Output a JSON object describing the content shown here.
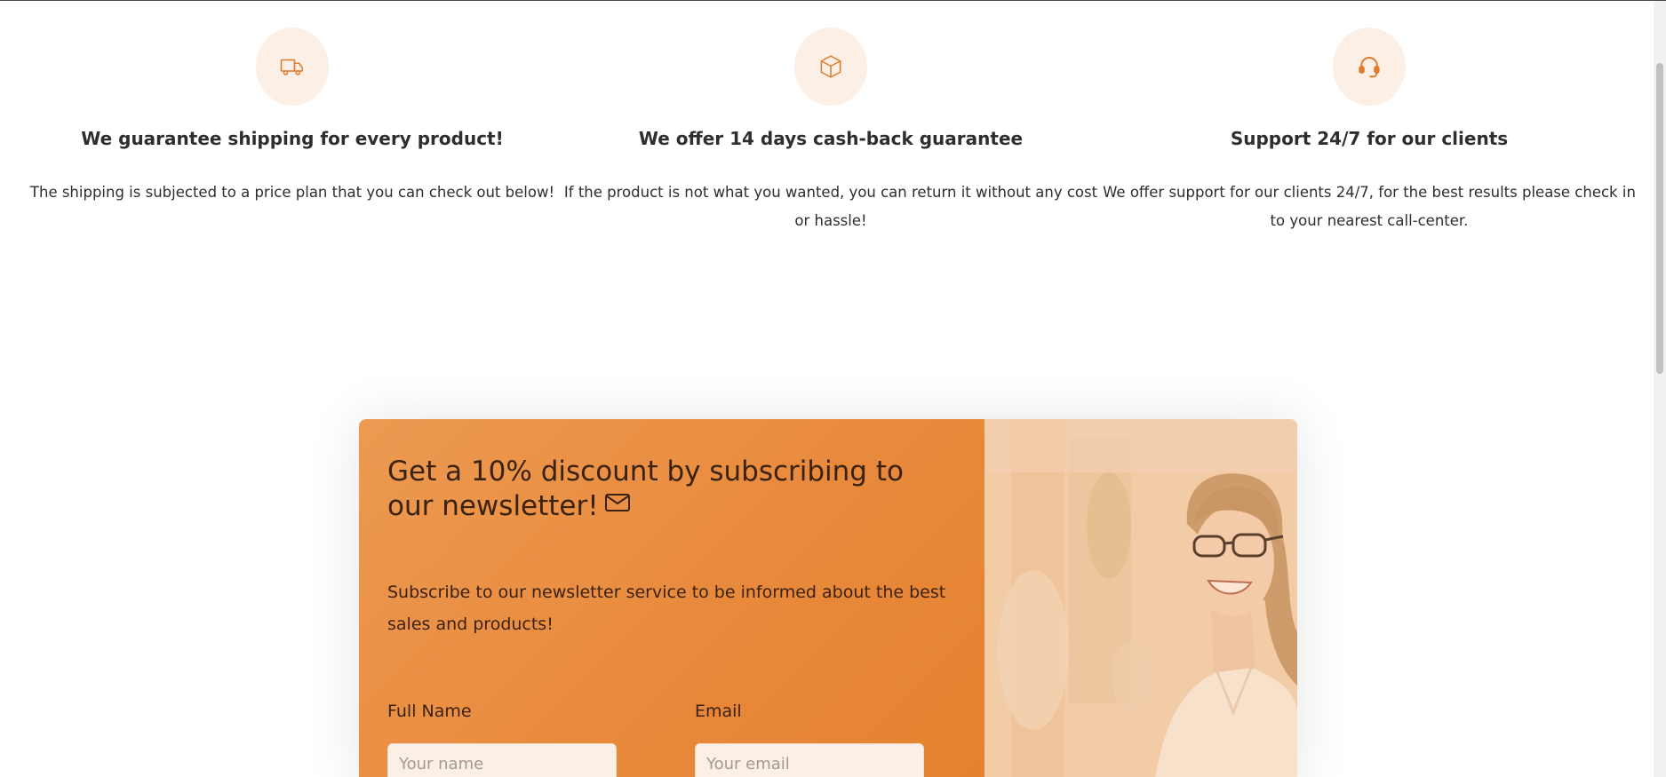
{
  "features": [
    {
      "icon": "truck-icon",
      "title": "We guarantee shipping for every product!",
      "text": "The shipping is subjected to a price plan that you can check out below!"
    },
    {
      "icon": "box-icon",
      "title": "We offer 14 days cash-back guarantee",
      "text": "If the product is not what you wanted, you can return it without any cost or hassle!"
    },
    {
      "icon": "headset-icon",
      "title": "Support 24/7 for our clients",
      "text": "We offer support for our clients 24/7, for the best results please check in to your nearest call-center."
    }
  ],
  "newsletter": {
    "title": "Get a 10% discount by subscribing to our newsletter!",
    "title_icon": "mail-icon",
    "description": "Subscribe to our newsletter service to be informed about the best sales and products!",
    "fields": [
      {
        "label": "Full Name",
        "placeholder": "Your name",
        "value": ""
      },
      {
        "label": "Email",
        "placeholder": "Your email",
        "value": ""
      }
    ],
    "image": "smiling-woman-photo"
  },
  "colors": {
    "accent": "#e8883a",
    "icon_stroke": "#e07b2a",
    "icon_bg": "#fcefe6",
    "heading_dark": "#3b220f"
  }
}
